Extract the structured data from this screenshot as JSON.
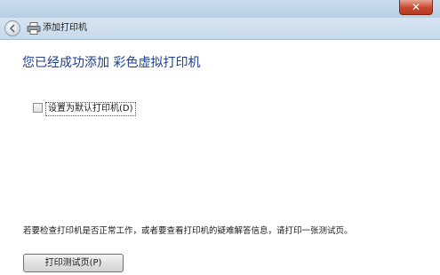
{
  "window": {
    "nav_title": "添加打印机",
    "close_glyph": "✕"
  },
  "main": {
    "heading": "您已经成功添加 彩色虚拟打印机",
    "default_printer_checkbox": {
      "label": "设置为默认打印机(D)",
      "checked": false
    },
    "info_text": "若要检查打印机是否正常工作，或者要查看打印机的疑难解答信息，请打印一张测试页。",
    "test_page_button": "打印测试页(P)"
  },
  "icons": {
    "back": "back-arrow-icon",
    "printer": "printer-icon",
    "close": "close-icon"
  },
  "colors": {
    "heading": "#1e3f8c",
    "close_button": "#c7462e"
  }
}
